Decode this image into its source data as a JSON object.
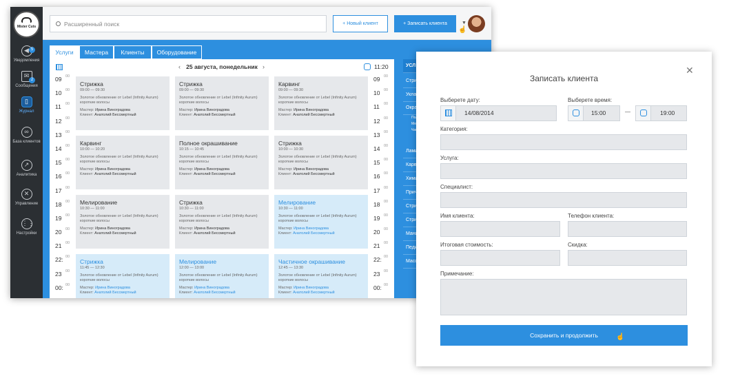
{
  "sidebar": {
    "logo_text": "Mister Cuts",
    "items": [
      {
        "label": "Уведомления",
        "badge": "5"
      },
      {
        "label": "Сообщения",
        "badge": "2"
      },
      {
        "label": "Журнал"
      },
      {
        "label": "База клиентов"
      },
      {
        "label": "Аналитика"
      },
      {
        "label": "Управление"
      },
      {
        "label": "Настройки"
      }
    ]
  },
  "topbar": {
    "search_placeholder": "Расширенный поиск",
    "new_client": "Новый клиент",
    "book_client": "Записать клиента"
  },
  "tabs": [
    "Услуги",
    "Мастера",
    "Клиенты",
    "Оборудование"
  ],
  "schedule": {
    "date": "25 августа, понедельник",
    "now": "11:20",
    "hours": [
      "09",
      "10",
      "11",
      "12",
      "13",
      "14",
      "15",
      "16",
      "17",
      "18",
      "19",
      "20",
      "21",
      "22:",
      "23",
      "00:"
    ],
    "minutes": "00",
    "cards": [
      {
        "title": "Стрижка",
        "time": "09:00 — 09:30",
        "desc": "Золотое обновление от Lebel (Infinity Aurum) короткие волосы",
        "master_label": "Мастер:",
        "master": "Ирина Виноградова",
        "client_label": "Клиент:",
        "client": "Анатолий Бессмертный"
      },
      {
        "title": "Стрижка",
        "time": "09:00 — 09:30",
        "desc": "Золотое обновление от Lebel (Infinity Aurum) короткие волосы",
        "master_label": "Мастер:",
        "master": "Ирина Виноградова",
        "client_label": "Клиент:",
        "client": "Анатолий Бессмертный"
      },
      {
        "title": "Карвинг",
        "time": "09:00 — 09:30",
        "desc": "Золотое обновление от Lebel (Infinity Aurum) короткие волосы",
        "master_label": "Мастер:",
        "master": "Ирина Виноградова",
        "client_label": "Клиент:",
        "client": "Анатолий Бессмертный"
      },
      {
        "title": "Карвинг",
        "time": "10:00 — 10:20",
        "desc": "Золотое обновление от Lebel (Infinity Aurum) короткие волосы",
        "master_label": "Мастер:",
        "master": "Ирина Виноградова",
        "client_label": "Клиент:",
        "client": "Анатолий Бессмертный"
      },
      {
        "title": "Полное окрашивание",
        "time": "10:15 — 10:45",
        "desc": "Золотое обновление от Lebel (Infinity Aurum) короткие волосы",
        "master_label": "Мастер:",
        "master": "Ирина Виноградова",
        "client_label": "Клиент:",
        "client": "Анатолий Бессмертный"
      },
      {
        "title": "Стрижка",
        "time": "10:00 — 10:30",
        "desc": "Золотое обновление от Lebel (Infinity Aurum) короткие волосы",
        "master_label": "Мастер:",
        "master": "Ирина Виноградова",
        "client_label": "Клиент:",
        "client": "Анатолий Бессмертный"
      },
      {
        "title": "Мелирование",
        "time": "10:30 — 11:00",
        "desc": "Золотое обновление от Lebel (Infinity Aurum) короткие волосы",
        "master_label": "Мастер:",
        "master": "Ирина Виноградова",
        "client_label": "Клиент:",
        "client": "Анатолий Бессмертный"
      },
      {
        "title": "Стрижка",
        "time": "10:30 — 11:00",
        "desc": "Золотое обновление от Lebel (Infinity Aurum) короткие волосы",
        "master_label": "Мастер:",
        "master": "Ирина Виноградова",
        "client_label": "Клиент:",
        "client": "Анатолий Бессмертный"
      },
      {
        "title": "Мелирование",
        "time": "10:30 — 11:00",
        "desc": "Золотое обновление от Lebel (Infinity Aurum) короткие волосы",
        "master_label": "Мастер:",
        "master": "Ирина Виноградова",
        "client_label": "Клиент:",
        "client": "Анатолий Бессмертный",
        "highlight": true
      },
      {
        "title": "Стрижка",
        "time": "11:45 — 12:30",
        "desc": "Золотое обновление от Lebel (Infinity Aurum) короткие волосы",
        "master_label": "Мастер:",
        "master": "Ирина Виноградова",
        "client_label": "Клиент:",
        "client": "Анатолий Бессмертный",
        "highlight": true
      },
      {
        "title": "Мелирование",
        "time": "12:00 — 13:00",
        "desc": "Золотое обновление от Lebel (Infinity Aurum) короткие волосы",
        "master_label": "Мастер:",
        "master": "Ирина Виноградова",
        "client_label": "Клиент:",
        "client": "Анатолий Бессмертный",
        "highlight": true
      },
      {
        "title": "Частичное окрашивание",
        "time": "12:45 — 13:30",
        "desc": "Золотое обновление от Lebel (Infinity Aurum) короткие волосы",
        "master_label": "Мастер:",
        "master": "Ирина Виноградова",
        "client_label": "Клиент:",
        "client": "Анатолий Бессмертный",
        "highlight": true
      }
    ]
  },
  "right_list": {
    "header": "УСЛ",
    "items": [
      "Стри",
      "Укла",
      "Окра",
      "Поли",
      "Мел",
      "Част",
      "Лами",
      "Карв",
      "Хими",
      "Приче",
      "Стри",
      "Стри",
      "Мани",
      "Педи",
      "Масс"
    ]
  },
  "modal": {
    "title": "Записать клиента",
    "date_label": "Выберете дату:",
    "date_value": "14/08/2014",
    "time_label": "Выберете время:",
    "time_from": "15:00",
    "time_to": "19:00",
    "dash": "—",
    "category_label": "Категория:",
    "service_label": "Услуга:",
    "specialist_label": "Специалист:",
    "client_name_label": "Имя клиента:",
    "client_phone_label": "Телефон клиента:",
    "total_label": "Итоговая стоимость:",
    "discount_label": "Скидка:",
    "note_label": "Примечание:",
    "save_button": "Сохранить и продолжить"
  },
  "colors": {
    "accent": "#2d8fdf",
    "sidebar": "#2b2f33",
    "card": "#e6e8eb",
    "card_highlight": "#d6ebf9"
  }
}
